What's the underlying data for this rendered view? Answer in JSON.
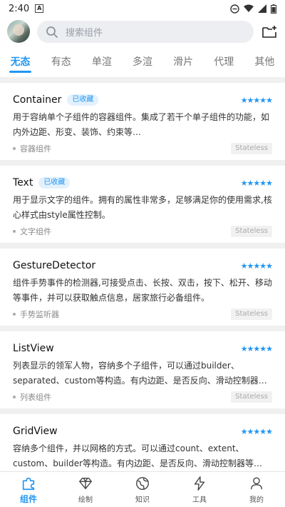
{
  "status_bar": {
    "time": "2:40",
    "notification_glyph": "A"
  },
  "search": {
    "placeholder": "搜索组件"
  },
  "tabs": [
    {
      "label": "无态",
      "active": true
    },
    {
      "label": "有态",
      "active": false
    },
    {
      "label": "单渲",
      "active": false
    },
    {
      "label": "多渲",
      "active": false
    },
    {
      "label": "滑片",
      "active": false
    },
    {
      "label": "代理",
      "active": false
    },
    {
      "label": "其他",
      "active": false
    }
  ],
  "cards": [
    {
      "title": "Container",
      "badge": "已收藏",
      "stars": "★★★★★",
      "desc": "用于容纳单个子组件的容器组件。集成了若干个单子组件的功能，如内外边距、形变、装饰、约束等…",
      "category": "容器组件",
      "tag": "Stateless"
    },
    {
      "title": "Text",
      "badge": "已收藏",
      "stars": "★★★★★",
      "desc": "用于显示文字的组件。拥有的属性非常多，足够满足你的使用需求,核心样式由style属性控制。",
      "category": "文字组件",
      "tag": "Stateless"
    },
    {
      "title": "GestureDetector",
      "badge": "",
      "stars": "★★★★★",
      "desc": "组件手势事件的检测器,可接受点击、长按、双击，按下、松开、移动等事件，并可以获取触点信息，居家旅行必备组件。",
      "category": "手势监听器",
      "tag": "Stateless"
    },
    {
      "title": "ListView",
      "badge": "",
      "stars": "★★★★★",
      "desc": "列表显示的领军人物，容纳多个子组件，可以通过builder、separated、custom等构造。有内边距、是否反向、滑动控制器…",
      "category": "列表组件",
      "tag": "Stateless"
    },
    {
      "title": "GridView",
      "badge": "",
      "stars": "★★★★★",
      "desc": "容纳多个组件，并以网格的方式。可以通过count、extent、custom、builder等构造。有内边距、是否反向、滑动控制器等…",
      "category": "",
      "tag": ""
    }
  ],
  "bottom_nav": [
    {
      "label": "组件",
      "icon": "puzzle-icon",
      "active": true
    },
    {
      "label": "绘制",
      "icon": "diamond-icon",
      "active": false
    },
    {
      "label": "知识",
      "icon": "globe-icon",
      "active": false
    },
    {
      "label": "工具",
      "icon": "lightning-icon",
      "active": false
    },
    {
      "label": "我的",
      "icon": "person-icon",
      "active": false
    }
  ],
  "colors": {
    "accent": "#2196f3",
    "background": "#f0f0f0",
    "tag_bg": "#f1f1f1"
  }
}
